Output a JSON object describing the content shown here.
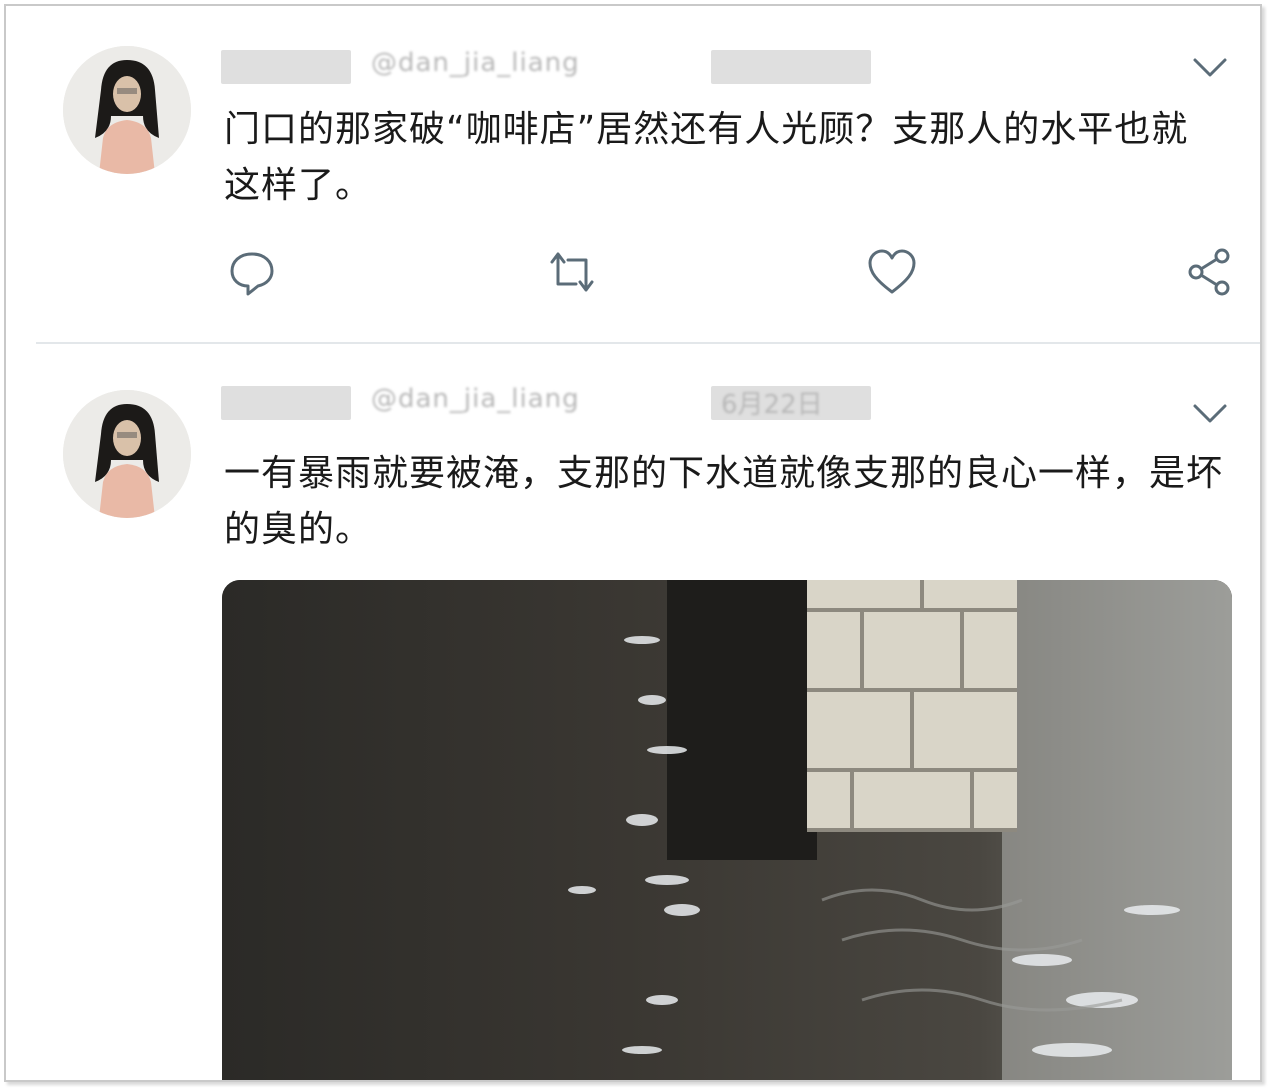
{
  "tweets": [
    {
      "handle_fragment": "@dan_jia_liang",
      "text": "门口的那家破“咖啡店”居然还有人光顾？支那人的水平也就这样了。",
      "actions": [
        "reply-icon",
        "retweet-icon",
        "like-icon",
        "share-icon"
      ]
    },
    {
      "handle_fragment": "@dan_jia_liang",
      "date_fragment": "6月22日",
      "text": "一有暴雨就要被淹，支那的下水道就像支那的良心一样，是坏的臭的。",
      "media": "flooded-street-photo"
    }
  ],
  "colors": {
    "icon": "#5b6c78",
    "divider": "#e3e7ea",
    "text": "#1a1a1a"
  }
}
